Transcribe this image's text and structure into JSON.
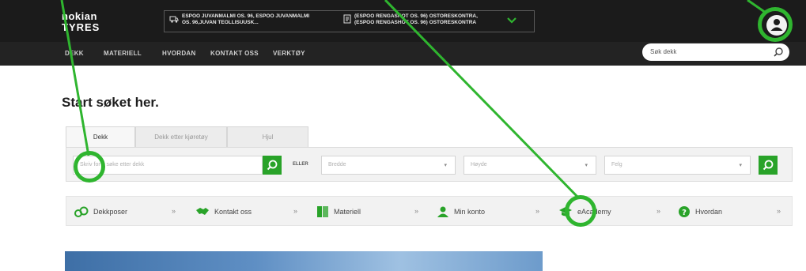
{
  "header": {
    "logo_line1": "nokian",
    "logo_line2": "TYRES",
    "location1": "ESPOO JUVANMALMI OS. 96, ESPOO JUVANMALMI\nOS. 96,JUVAN TEOLLISUUSK...",
    "location2": "(ESPOO RENGASHOT OS. 96) OSTORESKONTRA,\n(ESPOO RENGASHOT OS. 96) OSTORESKONTRA"
  },
  "nav": {
    "items": [
      "DEKK",
      "MATERIELL",
      "HVORDAN",
      "KONTAKT OSS",
      "VERKTØY"
    ],
    "search_placeholder": "Søk dekk"
  },
  "main": {
    "title": "Start søket her.",
    "tabs": [
      "Dekk",
      "Dekk etter kjøretøy",
      "Hjul"
    ],
    "search_placeholder": "Skriv for å søke etter dekk",
    "or_label": "ELLER",
    "selects": [
      "Bredde",
      "Høyde",
      "Felg"
    ]
  },
  "quick_links": [
    {
      "label": "Dekkposer",
      "icon": "tire-bag-icon"
    },
    {
      "label": "Kontakt oss",
      "icon": "handshake-icon"
    },
    {
      "label": "Materiell",
      "icon": "book-icon"
    },
    {
      "label": "Min konto",
      "icon": "person-icon"
    },
    {
      "label": "eAcademy",
      "icon": "graduation-cap-icon"
    },
    {
      "label": "Hvordan",
      "icon": "question-icon"
    }
  ],
  "colors": {
    "accent": "#29a329",
    "annotation": "#2fb52f",
    "header_bg": "#1b1b1b"
  }
}
